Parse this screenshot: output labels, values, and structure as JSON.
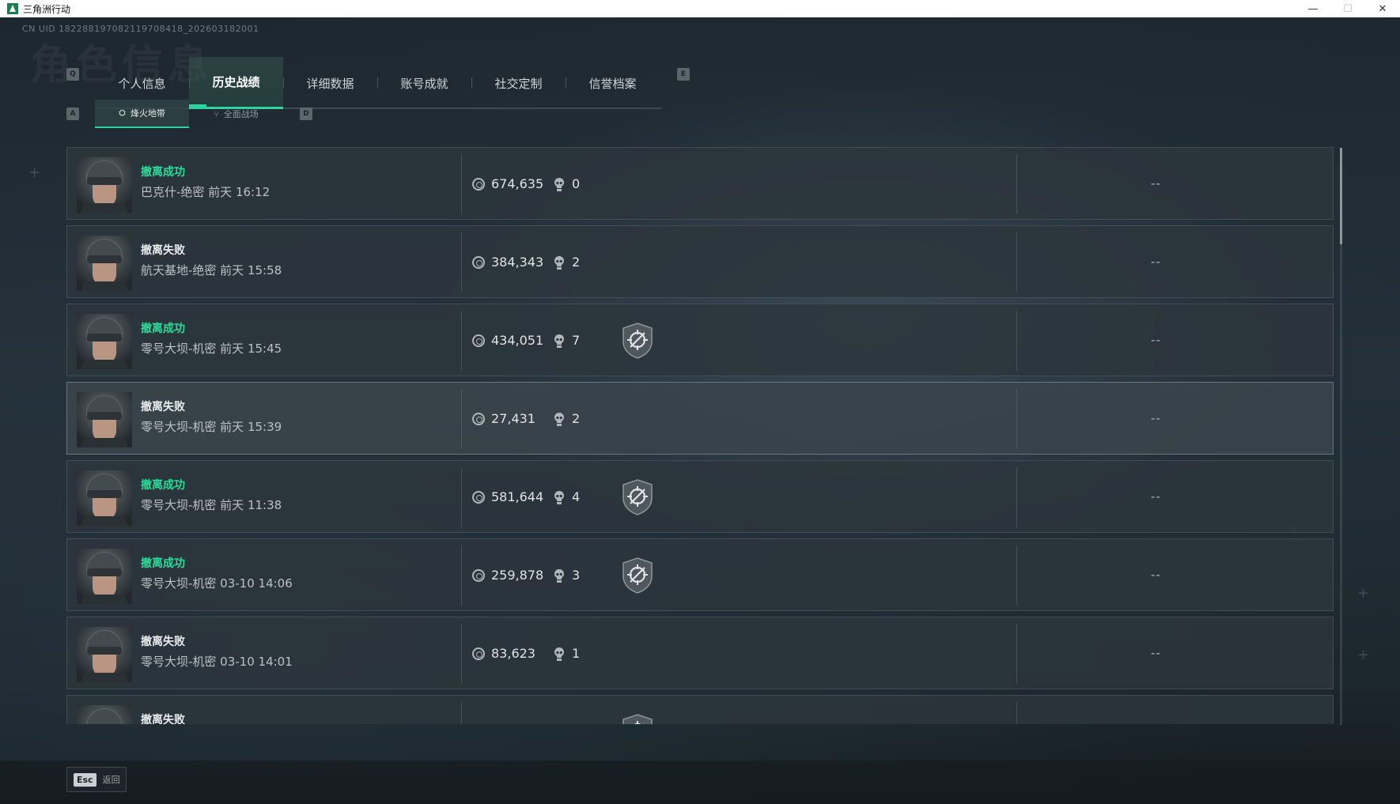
{
  "window": {
    "title": "三角洲行动",
    "controls": [
      "—",
      "☐",
      "✕"
    ]
  },
  "header": {
    "uid": "CN UID 18228819708211970841​8_202603182001",
    "watermark": "角色信息"
  },
  "tabs": {
    "prev_key": "Q",
    "next_key": "E",
    "items": [
      {
        "label": "个人信息",
        "active": false
      },
      {
        "label": "历史战绩",
        "active": true
      },
      {
        "label": "详细数据",
        "active": false
      },
      {
        "label": "账号成就",
        "active": false
      },
      {
        "label": "社交定制",
        "active": false
      },
      {
        "label": "信誉档案",
        "active": false
      }
    ]
  },
  "subtabs": {
    "prev_key": "A",
    "next_key": "D",
    "items": [
      {
        "label": "烽火地带",
        "icon": "fire-zone-icon",
        "active": true
      },
      {
        "label": "全面战场",
        "icon": "battlefield-icon",
        "active": false
      }
    ]
  },
  "matches": [
    {
      "status": "撤离成功",
      "success": true,
      "map_time": "巴克什-绝密 前天 16:12",
      "value": "674,635",
      "kills": "0",
      "badge": false,
      "extra": "--"
    },
    {
      "status": "撤离失败",
      "success": false,
      "map_time": "航天基地-绝密 前天 15:58",
      "value": "384,343",
      "kills": "2",
      "badge": false,
      "extra": "--"
    },
    {
      "status": "撤离成功",
      "success": true,
      "map_time": "零号大坝-机密 前天 15:45",
      "value": "434,051",
      "kills": "7",
      "badge": true,
      "extra": "--"
    },
    {
      "status": "撤离失败",
      "success": false,
      "map_time": "零号大坝-机密 前天 15:39",
      "value": "27,431",
      "kills": "2",
      "badge": false,
      "extra": "--",
      "highlight": true
    },
    {
      "status": "撤离成功",
      "success": true,
      "map_time": "零号大坝-机密 前天 11:38",
      "value": "581,644",
      "kills": "4",
      "badge": true,
      "extra": "--"
    },
    {
      "status": "撤离成功",
      "success": true,
      "map_time": "零号大坝-机密 03-10 14:06",
      "value": "259,878",
      "kills": "3",
      "badge": true,
      "extra": "--"
    },
    {
      "status": "撤离失败",
      "success": false,
      "map_time": "零号大坝-机密 03-10 14:01",
      "value": "83,623",
      "kills": "1",
      "badge": false,
      "extra": "--"
    },
    {
      "status": "撤离失败",
      "success": false,
      "map_time": "",
      "value": "",
      "kills": "",
      "badge": true,
      "extra": ""
    }
  ],
  "footer": {
    "esc_key": "Esc",
    "back_label": "返回"
  },
  "colors": {
    "accent": "#2ed3a0",
    "success": "#2edc9a",
    "panel": "#2c363d",
    "background": "#1d272f"
  }
}
